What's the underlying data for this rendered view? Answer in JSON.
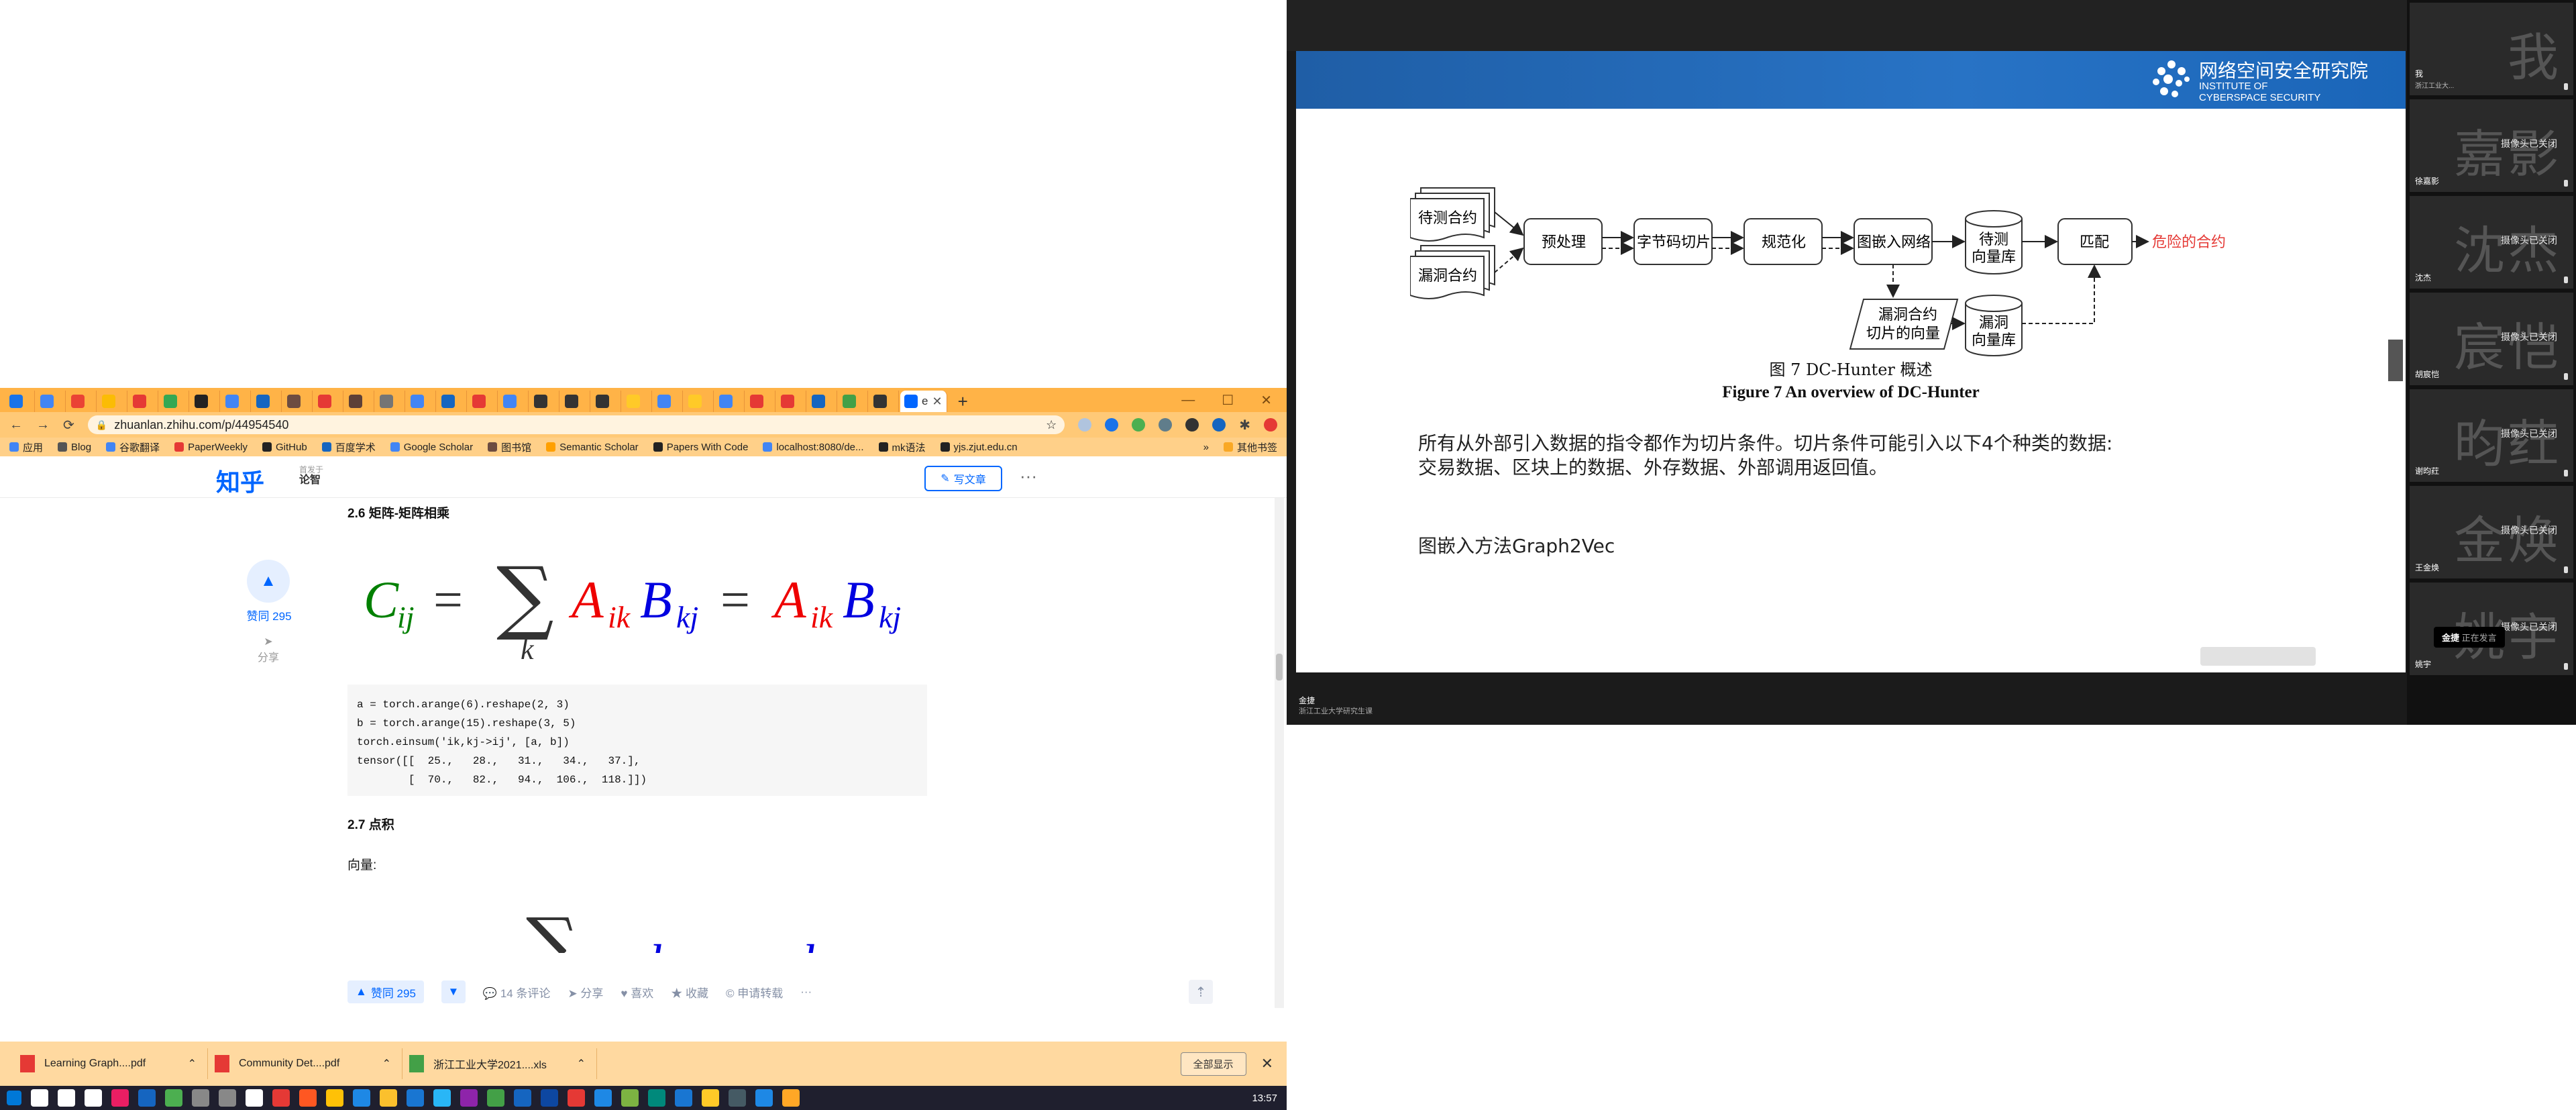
{
  "browser": {
    "tabs": [
      {
        "color": "#1a73e8"
      },
      {
        "color": "#4285f4"
      },
      {
        "color": "#ea4335"
      },
      {
        "color": "#fbbc05"
      },
      {
        "color": "#e53935"
      },
      {
        "color": "#34a853"
      },
      {
        "color": "#222222"
      },
      {
        "color": "#4285f4"
      },
      {
        "color": "#1565c0"
      },
      {
        "color": "#6d4c41"
      },
      {
        "color": "#e53935"
      },
      {
        "color": "#5d4037"
      },
      {
        "color": "#757575"
      },
      {
        "color": "#4285f4"
      },
      {
        "color": "#1565c0"
      },
      {
        "color": "#e53935"
      },
      {
        "color": "#4285f4"
      },
      {
        "color": "#333333"
      },
      {
        "color": "#333333"
      },
      {
        "color": "#333333"
      },
      {
        "color": "#ffca28"
      },
      {
        "color": "#4285f4"
      },
      {
        "color": "#ffca28"
      },
      {
        "color": "#4285f4"
      },
      {
        "color": "#e53935"
      },
      {
        "color": "#e53935"
      },
      {
        "color": "#1565c0"
      },
      {
        "color": "#43a047"
      },
      {
        "color": "#333333"
      }
    ],
    "active_tab_label": "e",
    "url": "zhuanlan.zhihu.com/p/44954540",
    "bookmarks": [
      {
        "label": "应用",
        "color": "#4285f4"
      },
      {
        "label": "Blog",
        "color": "#555555"
      },
      {
        "label": "谷歌翻译",
        "color": "#4285f4"
      },
      {
        "label": "PaperWeekly",
        "color": "#e53935"
      },
      {
        "label": "GitHub",
        "color": "#222222"
      },
      {
        "label": "百度学术",
        "color": "#1565c0"
      },
      {
        "label": "Google Scholar",
        "color": "#4285f4"
      },
      {
        "label": "图书馆",
        "color": "#6d4c41"
      },
      {
        "label": "Semantic Scholar",
        "color": "#ffa000"
      },
      {
        "label": "Papers With Code",
        "color": "#222222"
      },
      {
        "label": "localhost:8080/de...",
        "color": "#4285f4"
      },
      {
        "label": "mk语法",
        "color": "#222222"
      },
      {
        "label": "yjs.zjut.edu.cn",
        "color": "#222222"
      }
    ],
    "bookmarks_more": "»",
    "other_bookmarks": "其他书签"
  },
  "zhihu": {
    "logo": "知乎",
    "topic_prefix": "首发于",
    "topic": "论智",
    "write_btn": "写文章",
    "vote_count": "赞同 295",
    "share_label": "分享",
    "heading_26": "2.6 矩阵-矩阵相乘",
    "code_lines": "a = torch.arange(6).reshape(2, 3)\nb = torch.arange(15).reshape(3, 5)\ntorch.einsum('ik,kj->ij', [a, b])\ntensor([[  25.,   28.,   31.,   34.,   37.],\n        [  70.,   82.,   94.,  106.,  118.]])",
    "heading_27": "2.7 点积",
    "vector_label": "向量:",
    "actions": {
      "vote": "赞同 295",
      "comments": "14 条评论",
      "share": "分享",
      "like": "喜欢",
      "collect": "收藏",
      "repost": "申请转载",
      "more": "···"
    }
  },
  "downloads": {
    "items": [
      {
        "name": "Learning Graph....pdf",
        "color": "#e53935"
      },
      {
        "name": "Community Det....pdf",
        "color": "#e53935"
      },
      {
        "name": "浙江工业大学2021....xls",
        "color": "#43a047"
      }
    ],
    "show_all": "全部显示"
  },
  "taskbar": {
    "icons": [
      "#0078d7",
      "#ffffff",
      "#ffffff",
      "#ffffff",
      "#e91e63",
      "#1565c0",
      "#4caf50",
      "#888888",
      "#888888",
      "#ffffff",
      "#e53935",
      "#ff5722",
      "#ffc107",
      "#1e88e5",
      "#fbc02d",
      "#1976d2",
      "#29b6f6",
      "#8e24aa",
      "#43a047",
      "#1565c0",
      "#0d47a1",
      "#e53935",
      "#1e88e5",
      "#7cb342",
      "#00897b",
      "#1976d2",
      "#ffca28",
      "#455a64",
      "#1e88e5",
      "#ffa726"
    ],
    "clock": "13:57"
  },
  "meeting": {
    "institute_cn": "网络空间安全研究院",
    "institute_en_1": "INSTITUTE OF",
    "institute_en_2": "CYBERSPACE SECURITY",
    "flow": {
      "input1": "待测合约",
      "input2": "漏洞合约",
      "preprocess": "预处理",
      "slice": "字节码切片",
      "normalize": "规范化",
      "embed": "图嵌入网络",
      "db1_a": "待测",
      "db1_b": "向量库",
      "match": "匹配",
      "output": "危险的合约",
      "para_a": "漏洞合约",
      "para_b": "切片的向量",
      "db2_a": "漏洞",
      "db2_b": "向量库"
    },
    "caption_cn": "图 7    DC-Hunter 概述",
    "caption_en": "Figure 7    An overview of DC-Hunter",
    "para_line1": "所有从外部引入数据的指令都作为切片条件。切片条件可能引入以下4个种类的数据:",
    "para_line2": "交易数据、区块上的数据、外存数据、外部调用返回值。",
    "graph2vec": "图嵌入方法Graph2Vec",
    "presenter_name": "金捷",
    "presenter_org": "浙江工业大学研究生课",
    "participants": [
      {
        "big": "我",
        "name": "我",
        "sub": "浙江工业大..."
      },
      {
        "big": "嘉影",
        "name": "徐嘉影",
        "cam": "摄像头已关闭"
      },
      {
        "big": "沈杰",
        "name": "沈杰",
        "cam": "摄像头已关闭"
      },
      {
        "big": "宸恺",
        "name": "胡宸恺",
        "cam": "摄像头已关闭"
      },
      {
        "big": "昀荭",
        "name": "谢昀荭",
        "cam": "摄像头已关闭"
      },
      {
        "big": "金焕",
        "name": "王金焕",
        "cam": "摄像头已关闭"
      },
      {
        "big": "姚宇",
        "name": "姚宇",
        "cam": "摄像头已关闭"
      }
    ],
    "toast_name": "金捷",
    "toast_status": "正在发言"
  }
}
